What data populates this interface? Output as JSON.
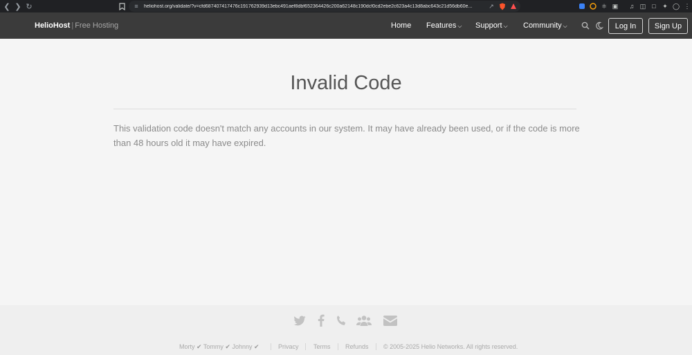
{
  "browser": {
    "url": "heliohost.org/validate/?v=cfd687407417476c191762939d13ebc491aef8dbf652364426c200a62148c190dcf0cd2ebe2c623a4c13d8abc643c21d56db60e...",
    "brave_badge": "9"
  },
  "header": {
    "brand_name": "HelioHost",
    "brand_sep": "|",
    "brand_tag": "Free Hosting",
    "nav": {
      "home": "Home",
      "features": "Features",
      "support": "Support",
      "community": "Community"
    },
    "login": "Log In",
    "signup": "Sign Up"
  },
  "main": {
    "title": "Invalid Code",
    "message": "This validation code doesn't match any accounts in our system. It may have already been used, or if the code is more than 48 hours old it may have expired."
  },
  "footer": {
    "admins": [
      "Morty",
      "Tommy",
      "Johnny"
    ],
    "privacy": "Privacy",
    "terms": "Terms",
    "refunds": "Refunds",
    "copyright": "© 2005-2025 Helio Networks. All rights reserved.",
    "social_icons": [
      "twitter-icon",
      "facebook-icon",
      "phone-icon",
      "users-icon",
      "envelope-icon"
    ]
  },
  "colors": {
    "header_bg": "#3b3b3b",
    "page_bg": "#f5f5f5",
    "footer_bg": "#efefef",
    "title": "#555555",
    "body_text": "#8a8a8a"
  }
}
